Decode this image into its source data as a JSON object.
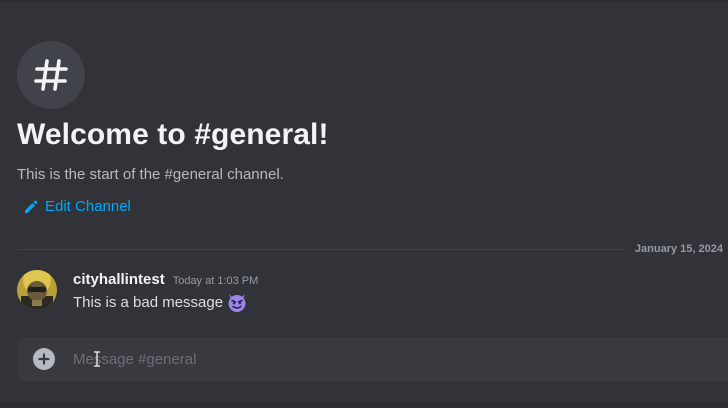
{
  "channel": {
    "hero_icon": "hash-icon",
    "welcome_title": "Welcome to #general!",
    "welcome_subtitle": "This is the start of the #general channel.",
    "edit_label": "Edit Channel",
    "edit_icon": "pencil-icon"
  },
  "divider": {
    "date": "January 15, 2024"
  },
  "message": {
    "username": "cityhallintest",
    "timestamp": "Today at 1:03 PM",
    "text": "This is a bad message",
    "emoji": "smiling-imp-emoji"
  },
  "composer": {
    "placeholder": "Message #general",
    "add_icon": "plus-circle-icon"
  },
  "colors": {
    "background": "#313338",
    "link": "#00a8fc",
    "title": "#f2f3f5",
    "muted": "#b5bac1",
    "composer_bg": "#383a40",
    "emoji_purple": "#9b84ec"
  }
}
